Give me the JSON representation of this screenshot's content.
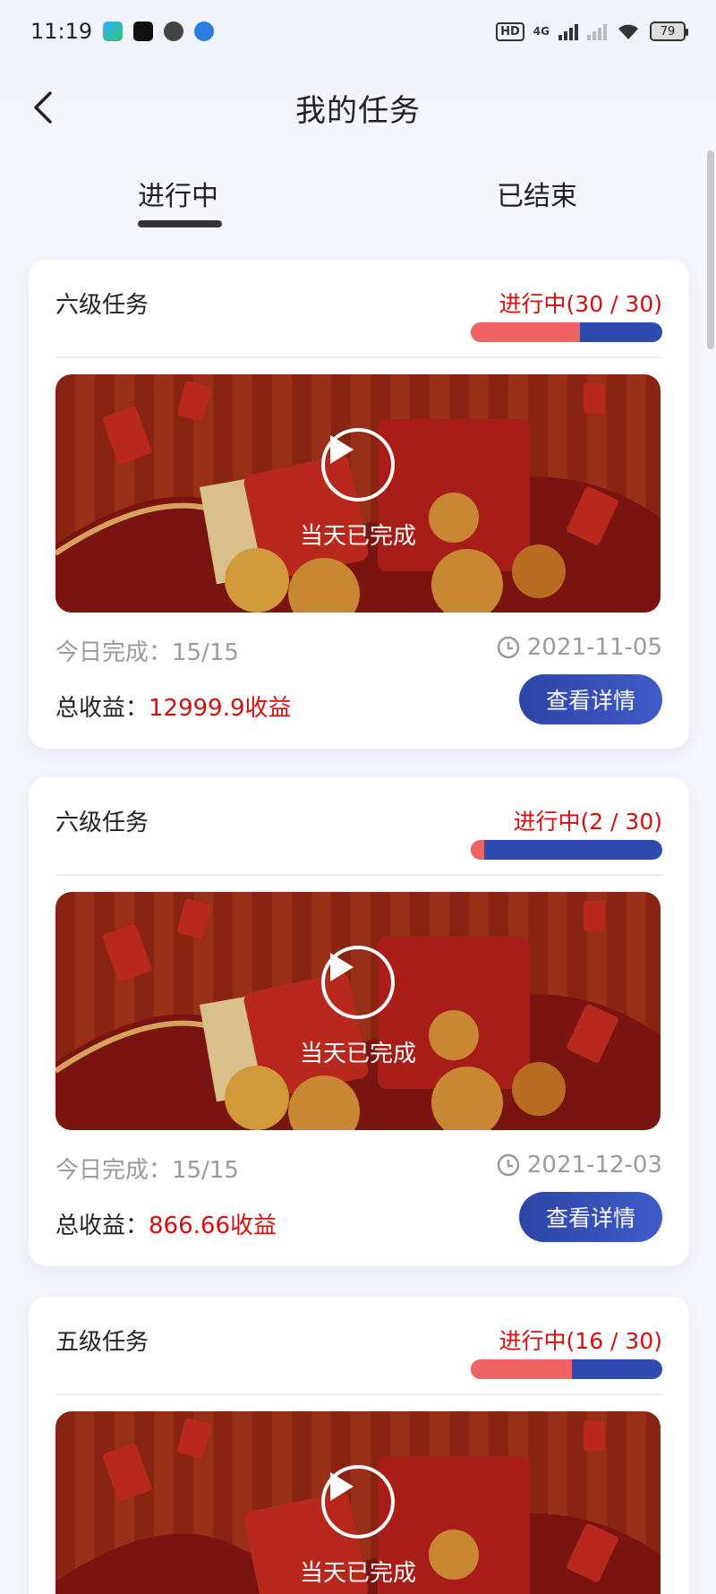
{
  "status_bar": {
    "time": "11:19",
    "hd": "HD",
    "network": "4G",
    "battery": "79"
  },
  "header": {
    "title": "我的任务"
  },
  "tabs": [
    {
      "label": "进行中",
      "active": true
    },
    {
      "label": "已结束",
      "active": false
    }
  ],
  "cards": [
    {
      "level": "六级任务",
      "status": "进行中(30 / 30)",
      "progress": 0.57,
      "banner_text": "当天已完成",
      "today": "今日完成：15/15",
      "date": "2021-11-05",
      "income_label": "总收益：",
      "income_value": "12999.9收益",
      "button": "查看详情"
    },
    {
      "level": "六级任务",
      "status": "进行中(2 / 30)",
      "progress": 0.07,
      "banner_text": "当天已完成",
      "today": "今日完成：15/15",
      "date": "2021-12-03",
      "income_label": "总收益：",
      "income_value": "866.66收益",
      "button": "查看详情"
    },
    {
      "level": "五级任务",
      "status": "进行中(16 / 30)",
      "progress": 0.53,
      "banner_text": "当天已完成"
    }
  ],
  "colors": {
    "accent_red": "#d20f0f",
    "accent_blue": "#2f4bb0",
    "progress_red": "#f06464"
  }
}
